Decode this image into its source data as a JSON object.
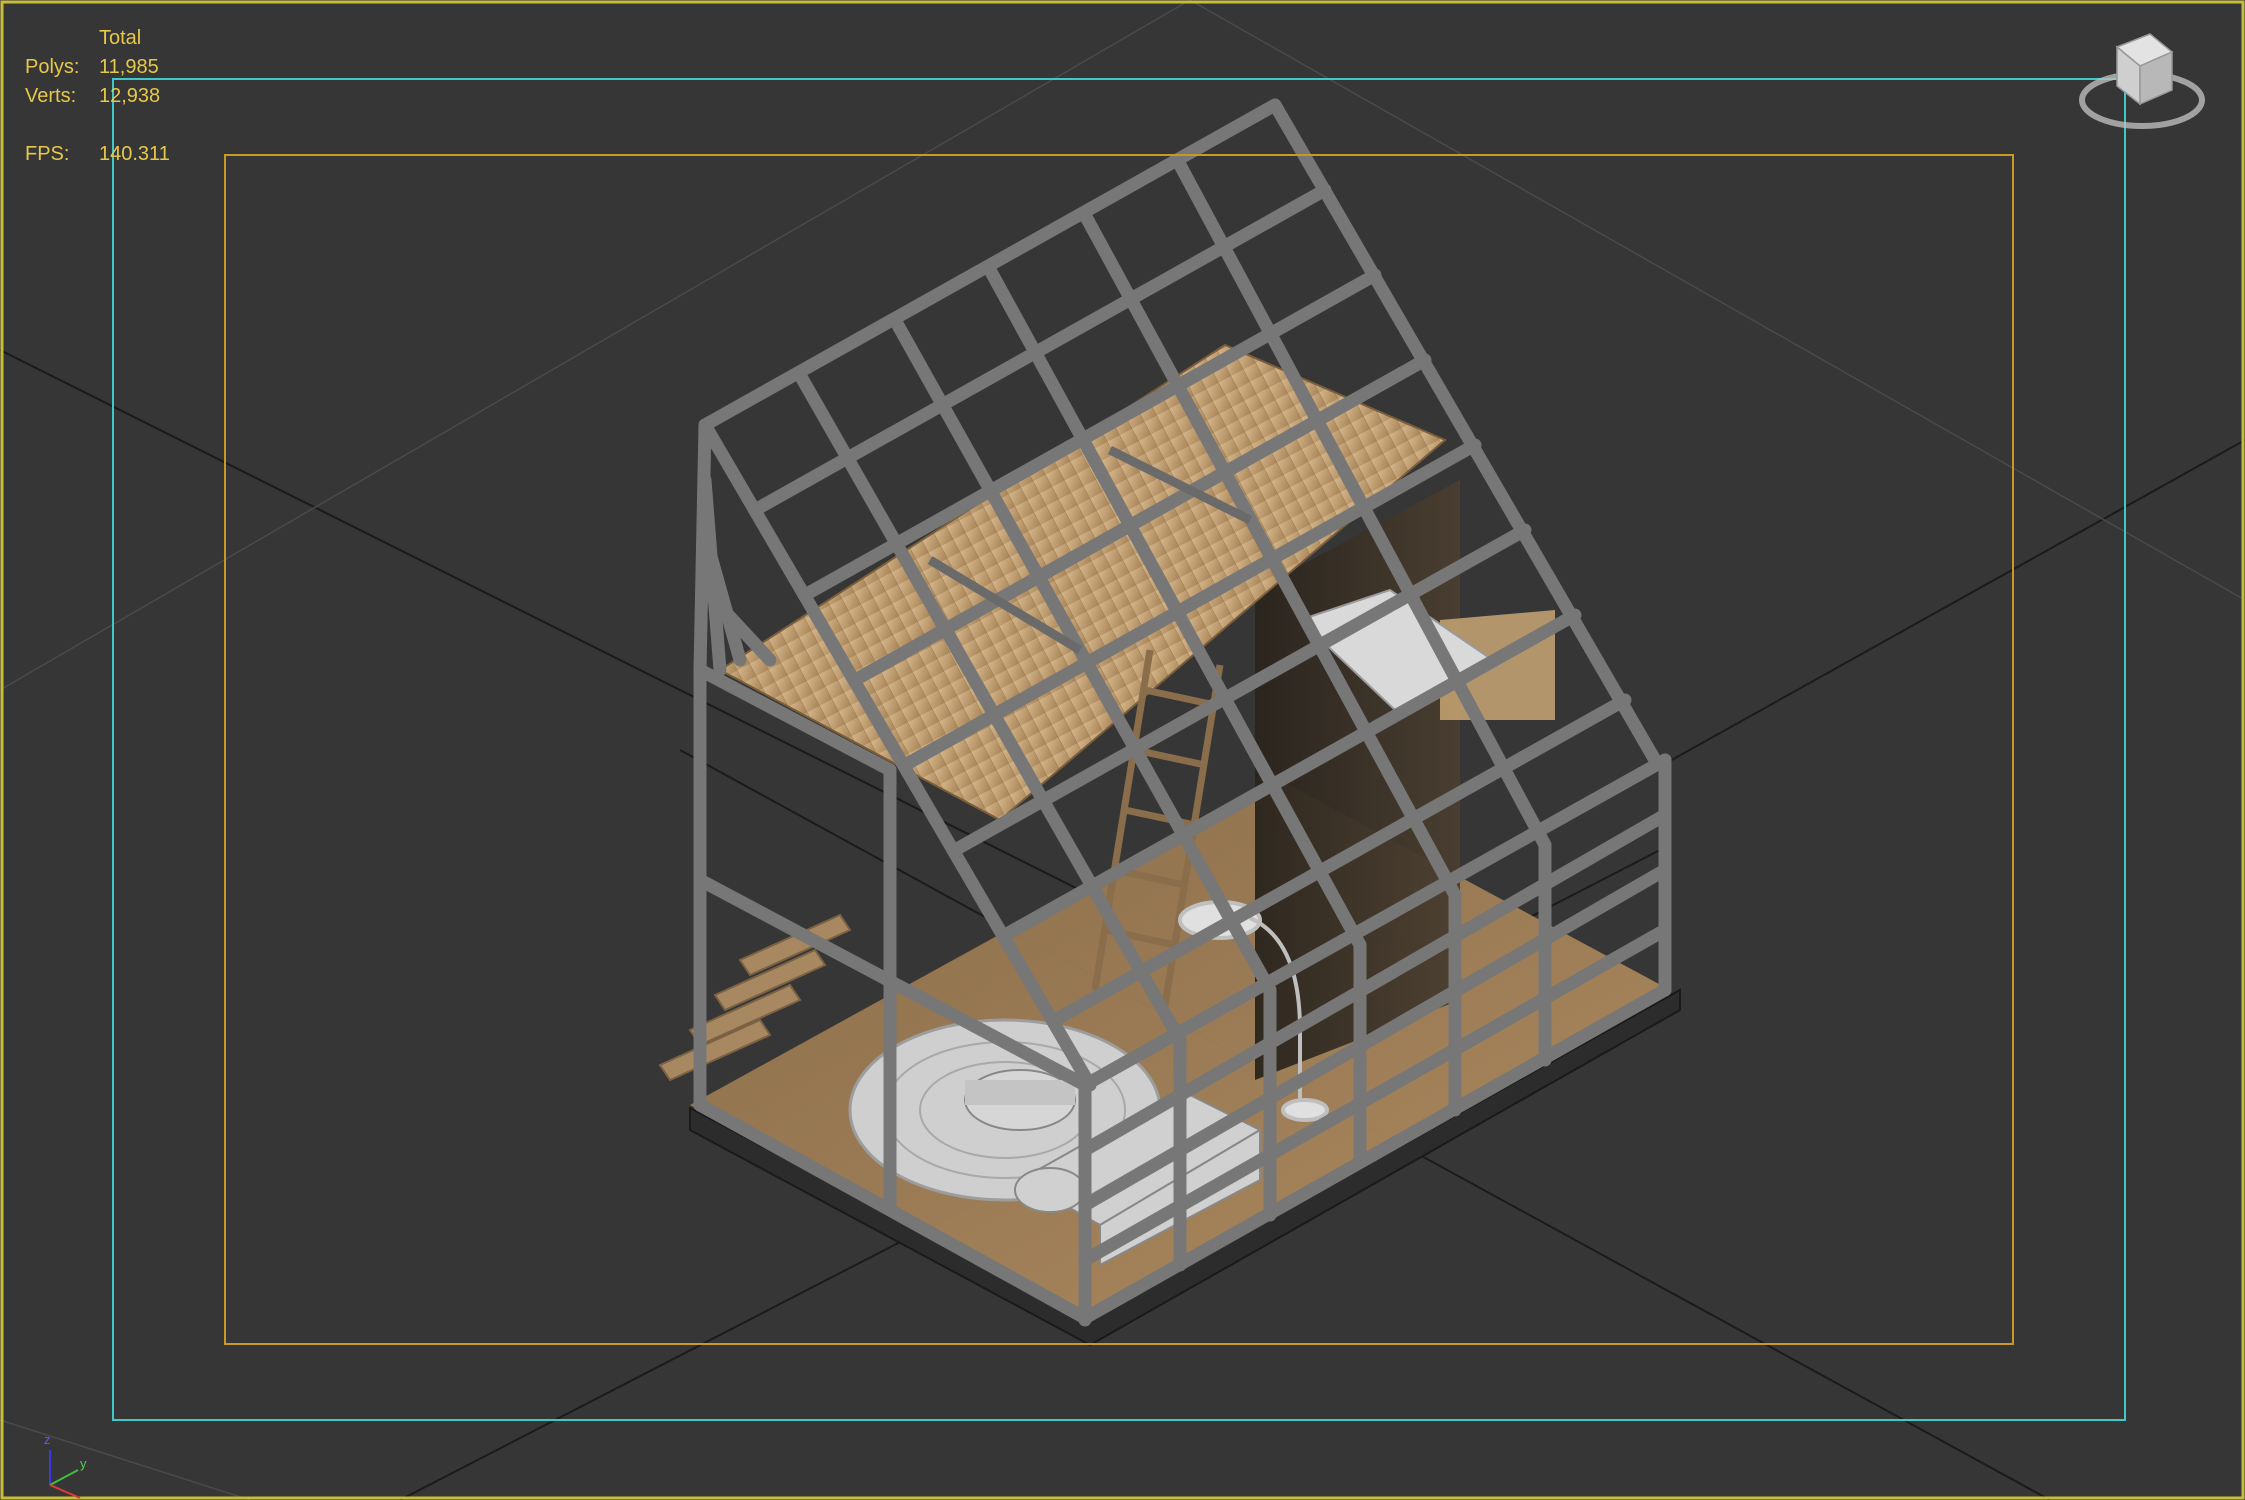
{
  "viewport": {
    "stats": {
      "header": "Total",
      "polys_label": "Polys:",
      "polys_value": "11,985",
      "verts_label": "Verts:",
      "verts_value": "12,938",
      "fps_label": "FPS:",
      "fps_value": "140.311"
    },
    "viewcube_icon": "viewcube-icon",
    "axis_icon": "axis-tripod-icon",
    "colors": {
      "background": "#363636",
      "stats_text": "#e6c84a",
      "outer_frame": "#c8bd3a",
      "safe_frame_action": "#3fc8c8",
      "safe_frame_title": "#c69a25",
      "grid_line": "#1a1a1a",
      "steel": "#7a7a7a",
      "wood": "#c9a97b"
    }
  }
}
